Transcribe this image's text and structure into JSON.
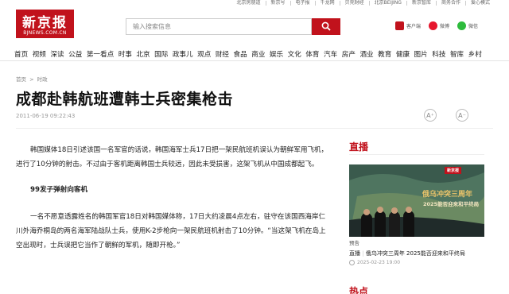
{
  "topbar": {
    "links": [
      "北京房朋道",
      "新京号",
      "电子报",
      "千龙网",
      "贝壳财经",
      "北京BEIJING",
      "新京智库",
      "商务合作",
      "爱心模式"
    ]
  },
  "logo": {
    "cn": "新京报",
    "en": "BJNEWS.COM.CN"
  },
  "search": {
    "placeholder": "输入搜索信息"
  },
  "social": {
    "items": [
      "客户端",
      "微博",
      "微信"
    ]
  },
  "nav": {
    "items": [
      "首页",
      "视频",
      "深读",
      "公益",
      "第一看点",
      "时事",
      "北京",
      "国际",
      "政事儿",
      "观点",
      "财经",
      "食品",
      "商业",
      "娱乐",
      "文化",
      "体育",
      "汽车",
      "房产",
      "酒业",
      "教育",
      "健康",
      "图片",
      "科技",
      "智库",
      "乡村"
    ]
  },
  "breadcrumb": {
    "home": "首页",
    "sep": ">",
    "section": "时政"
  },
  "article": {
    "title": "成都赴韩航班遭韩士兵密集枪击",
    "date": "2011-06-19 09:22:43",
    "p1": "韩国媒体18日引述该国一名军官的话说，韩国海军士兵17日把一架民航班机误认为朝鲜军用飞机，进行了10分钟的射击。不过由于客机距离韩国士兵较远，因此未受损害，这架飞机从中国成都起飞。",
    "subheading": "99发子弹射向客机",
    "p2": "一名不愿意透露姓名的韩国军官18日对韩国媒体称，17日大约凌晨4点左右，驻守在该国西海岸仁川外海乔桐岛的两名海军陆战队士兵，使用K-2步枪向一架民航班机射击了10分钟。“当这架飞机在岛上空出现时，士兵误把它当作了朝鲜的军机，随即开枪。”"
  },
  "tools": {
    "font_large": "A⁺",
    "font_small": "A⁻"
  },
  "sidebar": {
    "live_title": "直播",
    "image_brand": "新京报",
    "image_headline1": "俄乌冲突三周年",
    "image_headline2": "2025能否迎来和平终局",
    "image_label": "预告",
    "link_prefix": "直播",
    "link_text": "俄乌冲突三周年 2025能否迎来和平终局",
    "time": "2025-02-23 19:00",
    "hot_title": "热点"
  },
  "colors": {
    "brand": "#c1121c"
  }
}
